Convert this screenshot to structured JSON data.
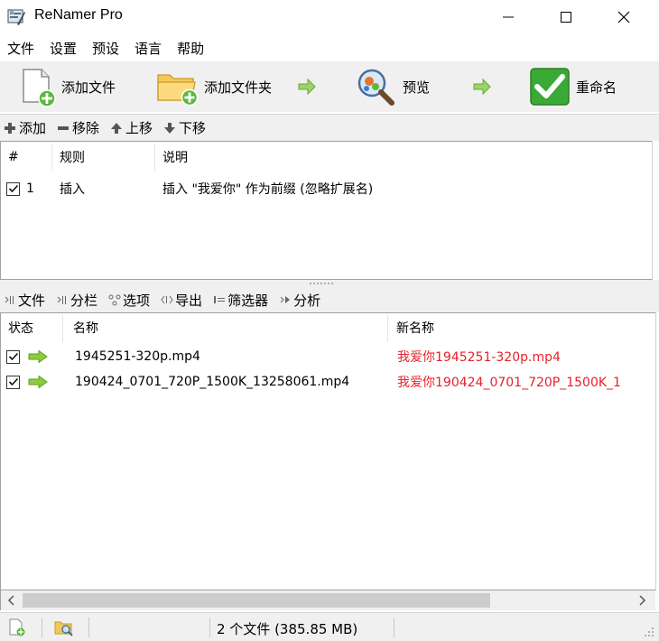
{
  "window": {
    "title": "ReNamer Pro"
  },
  "menu": {
    "items": [
      "文件",
      "设置",
      "预设",
      "语言",
      "帮助"
    ]
  },
  "toolbar": {
    "add_files": "添加文件",
    "add_folder": "添加文件夹",
    "preview": "预览",
    "rename": "重命名"
  },
  "rules_toolbar": {
    "add": "添加",
    "remove": "移除",
    "up": "上移",
    "down": "下移"
  },
  "rules_table": {
    "headers": [
      "#",
      "规则",
      "说明"
    ],
    "rows": [
      {
        "checked": true,
        "index": "1",
        "rule": "插入",
        "description": "插入 \"我爱你\" 作为前缀 (忽略扩展名)"
      }
    ]
  },
  "files_toolbar": {
    "tabs": [
      "文件",
      "分栏",
      "选项",
      "导出",
      "筛选器",
      "分析"
    ]
  },
  "files_table": {
    "headers": [
      "状态",
      "名称",
      "新名称"
    ],
    "rows": [
      {
        "checked": true,
        "name": "1945251-320p.mp4",
        "new_name": "我爱你1945251-320p.mp4"
      },
      {
        "checked": true,
        "name": "190424_0701_720P_1500K_13258061.mp4",
        "new_name": "我爱你190424_0701_720P_1500K_1"
      }
    ]
  },
  "status_bar": {
    "summary": "2 个文件 (385.85 MB)"
  },
  "colors": {
    "new_name": "#e8202a",
    "toolbar_bg": "#f0f0f0",
    "arrow_green": "#7ec43d",
    "rename_green": "#3aa935"
  }
}
